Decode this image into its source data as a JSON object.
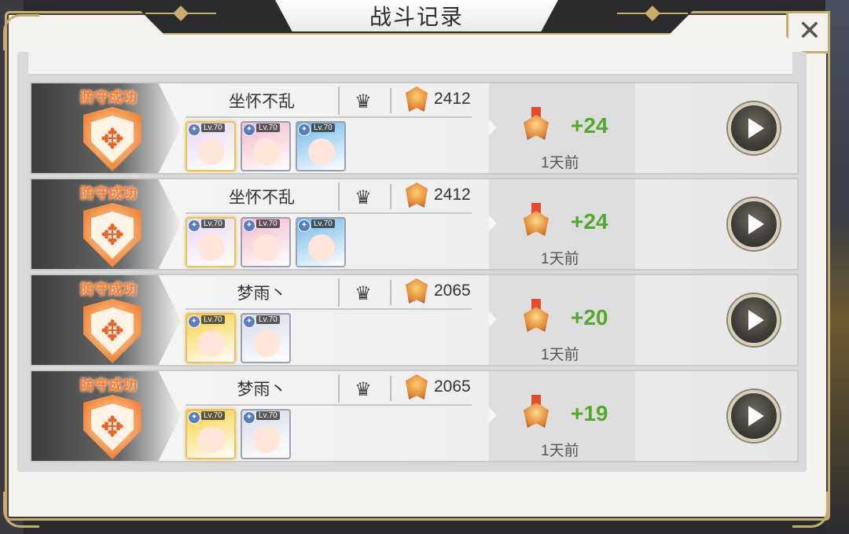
{
  "header": {
    "title": "战斗记录",
    "close_icon": "close-icon",
    "close_glyph": "✕"
  },
  "colors": {
    "accent_gold": "#c7ad6d",
    "status_orange": "#ff7b2c",
    "gain_green": "#52a830"
  },
  "records": [
    {
      "status": "防守成功",
      "player_name": "坐怀不乱",
      "trophies": "2412",
      "heroes": [
        {
          "level": "Lv.70",
          "frame": "gold",
          "portrait": "#e8d8f0"
        },
        {
          "level": "Lv.70",
          "frame": "normal",
          "portrait": "#f4b8cc"
        },
        {
          "level": "Lv.70",
          "frame": "normal",
          "portrait": "#6fb8e8"
        }
      ],
      "gain": "+24",
      "time": "1天前"
    },
    {
      "status": "防守成功",
      "player_name": "坐怀不乱",
      "trophies": "2412",
      "heroes": [
        {
          "level": "Lv.70",
          "frame": "gold",
          "portrait": "#e8d8f0"
        },
        {
          "level": "Lv.70",
          "frame": "normal",
          "portrait": "#f4b8cc"
        },
        {
          "level": "Lv.70",
          "frame": "normal",
          "portrait": "#6fb8e8"
        }
      ],
      "gain": "+24",
      "time": "1天前"
    },
    {
      "status": "防守成功",
      "player_name": "梦雨丶",
      "trophies": "2065",
      "heroes": [
        {
          "level": "Lv.70",
          "frame": "gold",
          "portrait": "#f6d040"
        },
        {
          "level": "Lv.70",
          "frame": "normal",
          "portrait": "#d8dbe8"
        }
      ],
      "gain": "+20",
      "time": "1天前"
    },
    {
      "status": "防守成功",
      "player_name": "梦雨丶",
      "trophies": "2065",
      "heroes": [
        {
          "level": "Lv.70",
          "frame": "gold",
          "portrait": "#f6d040"
        },
        {
          "level": "Lv.70",
          "frame": "normal",
          "portrait": "#d8dbe8"
        }
      ],
      "gain": "+19",
      "time": "1天前"
    }
  ]
}
